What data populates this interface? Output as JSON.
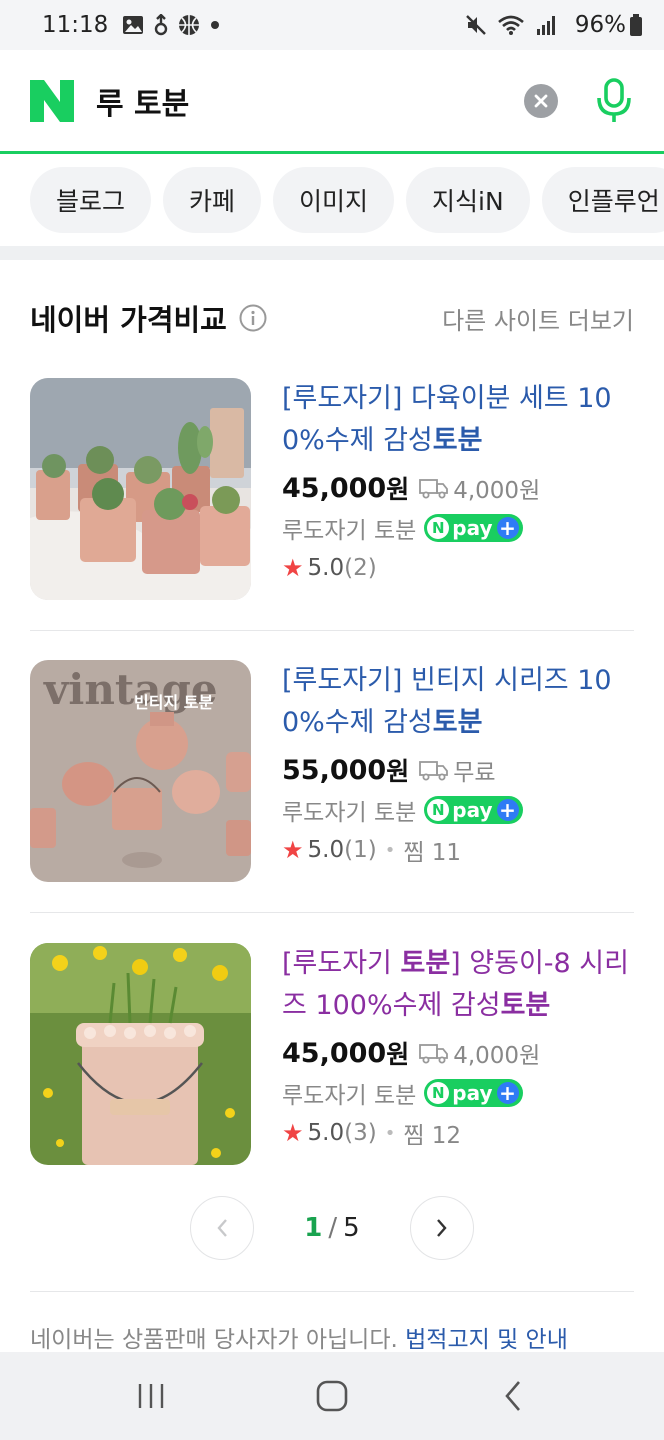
{
  "status_bar": {
    "time": "11:18",
    "battery": "96%"
  },
  "search": {
    "logo": "N",
    "query": "루 토분"
  },
  "tabs": [
    {
      "label": "블로그"
    },
    {
      "label": "카페"
    },
    {
      "label": "이미지"
    },
    {
      "label": "지식iN"
    },
    {
      "label": "인플루언"
    }
  ],
  "section": {
    "title": "네이버 가격비교",
    "more": "다른 사이트 더보기"
  },
  "products": [
    {
      "title_prefix": "[루도자기] 다육이분 세트 100%수제 감성",
      "title_bold": "토분",
      "price": "45,000",
      "price_unit": "원",
      "shipping": "4,000원",
      "seller": "루도자기 토분",
      "npay_text": "pay",
      "rating": "5.0",
      "review_count": "(2)",
      "zzim": ""
    },
    {
      "title_prefix": "[루도자기] 빈티지 시리즈 100%수제 감성",
      "title_bold": "토분",
      "price": "55,000",
      "price_unit": "원",
      "shipping": "무료",
      "seller": "루도자기 토분",
      "npay_text": "pay",
      "rating": "5.0",
      "review_count": "(1)",
      "zzim": "찜 11",
      "image_text": "vintage",
      "image_subtext": "빈티지 토분"
    },
    {
      "title_part1": "[루도자기 ",
      "title_bold1": "토분",
      "title_part2": "] 양동이-8 시리즈 100%수제 감성",
      "title_bold2": "토분",
      "price": "45,000",
      "price_unit": "원",
      "shipping": "4,000원",
      "seller": "루도자기 토분",
      "npay_text": "pay",
      "rating": "5.0",
      "review_count": "(3)",
      "zzim": "찜 12"
    }
  ],
  "pagination": {
    "current": "1",
    "separator": "/",
    "total": "5"
  },
  "footer": {
    "notice": "네이버는 상품판매 당사자가 아닙니다. ",
    "legal_link": "법적고지 및 안내"
  },
  "colors": {
    "naver_green": "#19ce60",
    "link_blue": "#2b5bab",
    "visited_purple": "#8a2ea1",
    "star_red": "#f04444"
  }
}
